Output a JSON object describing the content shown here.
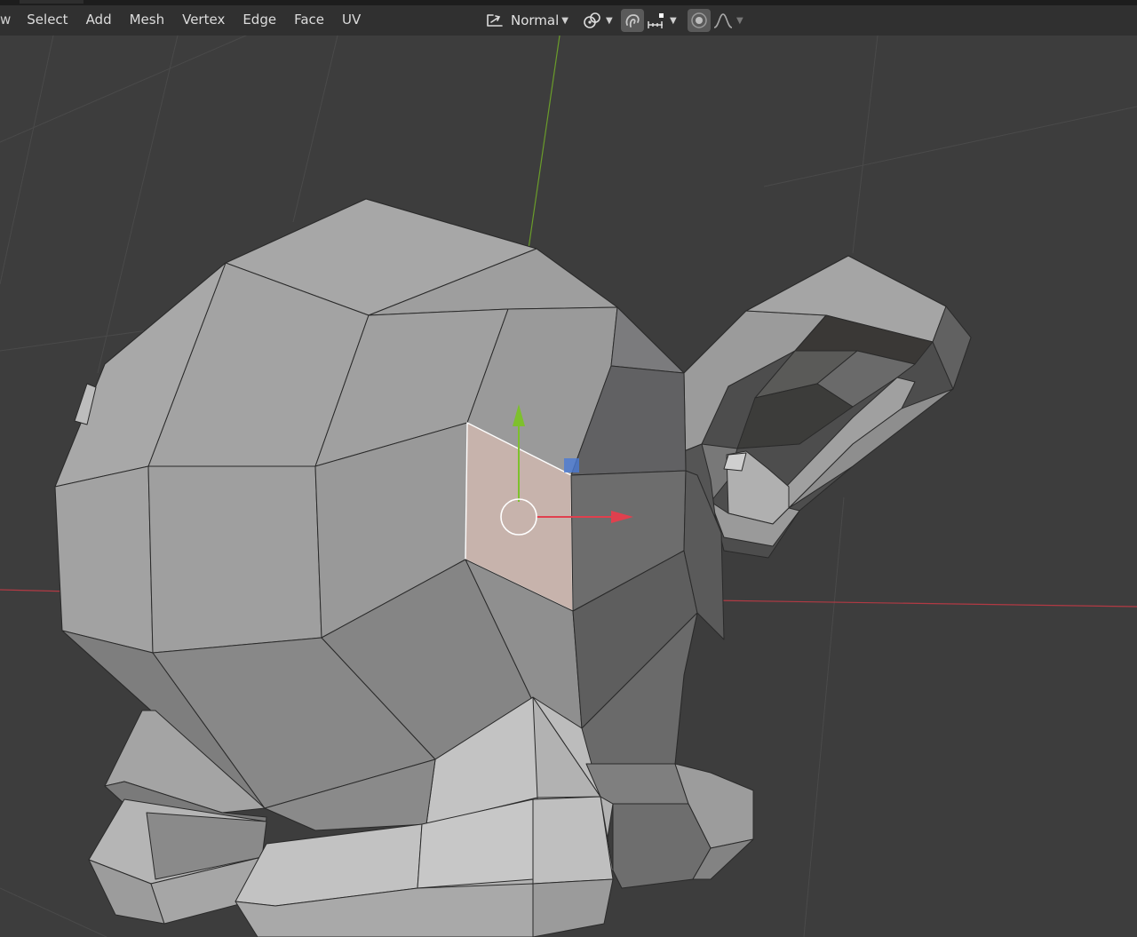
{
  "header": {
    "menu_fragment": "w",
    "menu": [
      "Select",
      "Add",
      "Mesh",
      "Vertex",
      "Edge",
      "Face",
      "UV"
    ],
    "transform_orientation": "Normal"
  },
  "icons": {
    "orientation": "transform-orientation-icon",
    "pivot": "pivot-point-icon",
    "snap": "snap-magnet-icon",
    "snap_target": "snap-increment-icon",
    "proportional": "proportional-editing-icon",
    "falloff": "falloff-curve-icon"
  },
  "colors": {
    "viewport_bg": "#3d3d3d",
    "header_bg": "#303030",
    "x_axis": "#e0404e",
    "y_axis": "#7ec02d",
    "z_axis": "#4a7bd6",
    "selected_face": "#c7b3ac"
  }
}
